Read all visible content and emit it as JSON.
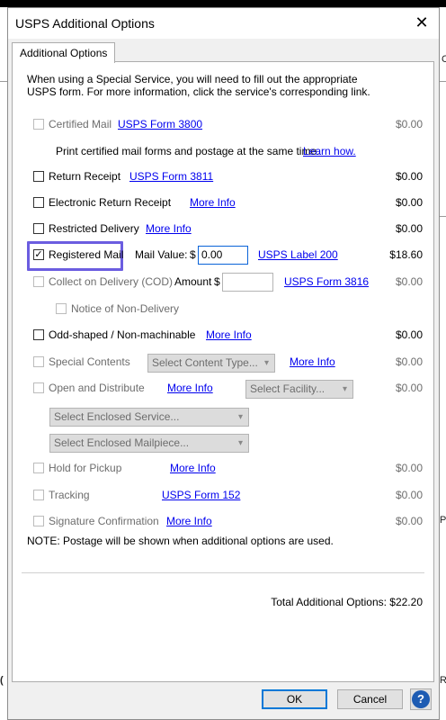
{
  "dialog": {
    "title": "USPS Additional Options",
    "tab": "Additional Options"
  },
  "intro": "When using a Special Service, you will need to fill out the appropriate USPS form.  For more information, click the service's corresponding link.",
  "certified": {
    "label": "Certified Mail",
    "link": "USPS Form 3800",
    "price": "$0.00"
  },
  "certified_note": {
    "text": "Print certified mail forms and postage at the same time.",
    "link": "Learn how."
  },
  "return_receipt": {
    "label": "Return Receipt",
    "link": "USPS Form 3811",
    "price": "$0.00"
  },
  "electronic_return_receipt": {
    "label": "Electronic Return Receipt",
    "link": "More Info",
    "price": "$0.00"
  },
  "restricted_delivery": {
    "label": "Restricted Delivery",
    "link": "More Info",
    "price": "$0.00"
  },
  "registered_mail": {
    "label": "Registered Mail",
    "checked": "✓",
    "value_label": "Mail Value:",
    "currency": "$",
    "value": "0.00",
    "link": "USPS Label 200",
    "price": "$18.60"
  },
  "cod": {
    "label": "Collect on Delivery (COD)",
    "amount_label": "Amount",
    "currency": "$",
    "link": "USPS Form 3816",
    "price": "$0.00"
  },
  "notice_non_delivery": {
    "label": "Notice of Non-Delivery"
  },
  "odd_shaped": {
    "label": "Odd-shaped / Non-machinable",
    "link": "More Info",
    "price": "$0.00"
  },
  "special_contents": {
    "label": "Special Contents",
    "select": "Select Content Type...",
    "link": "More Info",
    "price": "$0.00"
  },
  "open_distribute": {
    "label": "Open and Distribute",
    "link": "More Info",
    "facility": "Select Facility...",
    "price": "$0.00",
    "enclosed_service": "Select Enclosed Service...",
    "enclosed_mailpiece": "Select Enclosed Mailpiece..."
  },
  "hold_pickup": {
    "label": "Hold for Pickup",
    "link": "More Info",
    "price": "$0.00"
  },
  "tracking": {
    "label": "Tracking",
    "link": "USPS Form 152",
    "price": "$0.00"
  },
  "signature": {
    "label": "Signature Confirmation",
    "link": "More Info",
    "price": "$0.00"
  },
  "note": "NOTE: Postage will be shown when additional options are used.",
  "total": "Total Additional Options: $22.20",
  "buttons": {
    "ok": "OK",
    "cancel": "Cancel",
    "help": "?"
  },
  "icons": {
    "close": "close-icon",
    "help": "help-icon",
    "chevron": "chevron-down-icon",
    "checkmark": "checkmark-icon"
  },
  "background": {
    "frag1": "C",
    "frag2": "Pr",
    "frag3": "R"
  },
  "colors": {
    "highlight": "#6b5de0",
    "link": "#0000ee",
    "help": "#1e5cb3"
  }
}
